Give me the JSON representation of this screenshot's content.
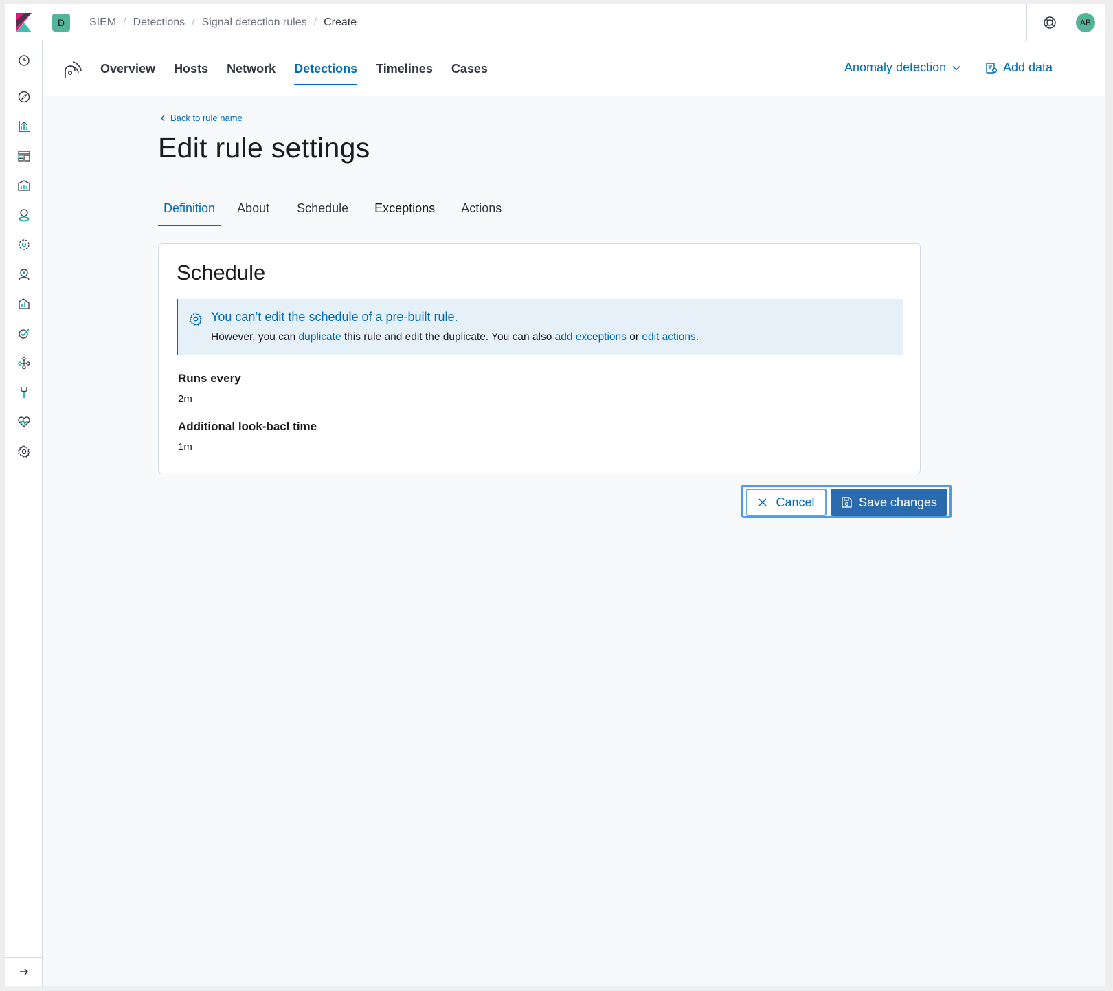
{
  "header": {
    "space_initial": "D",
    "breadcrumbs": [
      "SIEM",
      "Detections",
      "Signal detection rules",
      "Create"
    ],
    "avatar_initials": "AB"
  },
  "app_nav": {
    "tabs": [
      "Overview",
      "Hosts",
      "Network",
      "Detections",
      "Timelines",
      "Cases"
    ],
    "active_tab": "Detections",
    "anomaly_label": "Anomaly detection",
    "add_data_label": "Add data"
  },
  "page": {
    "back_link": "Back to rule name",
    "title": "Edit rule settings",
    "tabs": [
      "Definition",
      "About",
      "Schedule",
      "Exceptions",
      "Actions"
    ],
    "active_tab": "Definition"
  },
  "panel": {
    "title": "Schedule",
    "callout": {
      "title": "You can’t edit the schedule of a pre-built rule.",
      "body_1": "However, you can ",
      "link_duplicate": "duplicate",
      "body_2": " this rule and edit the duplicate. You can also ",
      "link_exceptions": "add exceptions",
      "body_3": " or ",
      "link_actions": "edit actions",
      "body_4": "."
    },
    "fields": [
      {
        "label": "Runs every",
        "value": "2m"
      },
      {
        "label": "Additional look-bacl time",
        "value": "1m"
      }
    ]
  },
  "buttons": {
    "cancel": "Cancel",
    "save": "Save changes"
  },
  "colors": {
    "accent": "#006bb4",
    "badge": "#54b399",
    "callout_bg": "#e6f0f8"
  }
}
